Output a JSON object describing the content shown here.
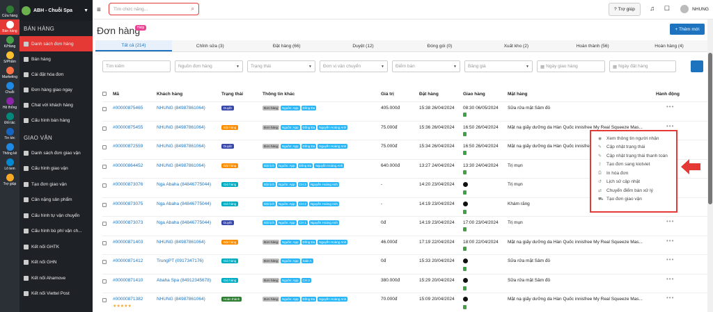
{
  "rail": [
    {
      "label": "Cửa hàng",
      "color": "#2e7d32"
    },
    {
      "label": "Bán hàng",
      "color": "#e53935",
      "active": true
    },
    {
      "label": "K/Hàng",
      "color": "#43a047"
    },
    {
      "label": "S/Phẩm",
      "color": "#fbc02d"
    },
    {
      "label": "Marketing",
      "color": "#ff7043"
    },
    {
      "label": "Chuỗi",
      "color": "#1e88e5"
    },
    {
      "label": "Hệ thống",
      "color": "#8e24aa"
    },
    {
      "label": "Đối tác",
      "color": "#00897b"
    },
    {
      "label": "Tin tức",
      "color": "#1565c0"
    },
    {
      "label": "Thống kê",
      "color": "#1e88e5"
    },
    {
      "label": "Lô tem",
      "color": "#0288d1"
    },
    {
      "label": "Trợ giúp",
      "color": "#f9a825"
    }
  ],
  "brand": {
    "name": "ABH - Chuỗi Spa"
  },
  "sidebar": {
    "sales_title": "BÁN HÀNG",
    "sales": [
      {
        "label": "Danh sách đơn hàng",
        "active": true
      },
      {
        "label": "Bán hàng"
      },
      {
        "label": "Cài đặt hóa đơn"
      },
      {
        "label": "Đơn hàng giao ngay"
      },
      {
        "label": "Chat với khách hàng"
      },
      {
        "label": "Cấu hình bán hàng"
      }
    ],
    "ship_title": "GIAO VẬN",
    "ship": [
      {
        "label": "Danh sách đơn giao vận"
      },
      {
        "label": "Cấu hình giao vận"
      },
      {
        "label": "Tạo đơn giao vận"
      },
      {
        "label": "Cân nặng sản phẩm"
      },
      {
        "label": "Cấu hình tự vận chuyển"
      },
      {
        "label": "Cấu hình bù phí vận ch..."
      },
      {
        "label": "Kết nối GHTK"
      },
      {
        "label": "Kết nối GHN"
      },
      {
        "label": "Kết nối Ahamove"
      },
      {
        "label": "Kết nối Viettel Post"
      }
    ]
  },
  "topbar": {
    "search_placeholder": "Tìm chức năng...",
    "help": "Trợ giúp",
    "user": "NHUNG"
  },
  "page": {
    "title": "Đơn hàng",
    "help_badge": "Help",
    "add_button": "+ Thêm mới"
  },
  "tabs": [
    "Tất cả (214)",
    "Chỉnh sửa (3)",
    "Đặt hàng (66)",
    "Duyệt (12)",
    "Đóng gói (0)",
    "Xuất kho (2)",
    "Hoàn thành (56)",
    "Hoàn hàng (4)"
  ],
  "filters": {
    "search": "Tìm kiếm",
    "source": "Nguồn đơn hàng",
    "status": "Trạng thái",
    "carrier": "Đơn vị vận chuyển",
    "point": "Điểm bán",
    "price": "Bảng giá",
    "ship_date": "Ngày giao hàng",
    "order_date": "Ngày đặt hàng"
  },
  "columns": [
    "Mã",
    "Khách hàng",
    "Trạng thái",
    "Thông tin khác",
    "Giá trị",
    "Đặt hàng",
    "Giao hàng",
    "Mặt hàng",
    "Hành động"
  ],
  "rows": [
    {
      "code": "#00000875465",
      "customer": "NHUNG (84987861064)",
      "status": "Duyệt",
      "status_color": "#3949ab",
      "tags": [
        [
          "Đơn hàng",
          "g"
        ],
        [
          "Nguồn: App",
          "c"
        ],
        [
          "Đống Đa",
          "c"
        ]
      ],
      "value": "405.000đ",
      "ordered": "15:38 26/04/2024",
      "delivery": "08:30 06/05/2024",
      "dtype": "green",
      "item": "Sữa rửa mặt Sâm đỏ"
    },
    {
      "code": "#00000875455",
      "customer": "NHUNG (84987861064)",
      "status": "Đặt hàng",
      "status_color": "#fb8c00",
      "tags": [
        [
          "Đơn hàng",
          "g"
        ],
        [
          "Nguồn: App",
          "c"
        ],
        [
          "Đống Đa",
          "c"
        ],
        [
          "Nguyễn Hoàng Anh",
          "c"
        ]
      ],
      "value": "75.000đ",
      "ordered": "15:36 26/04/2024",
      "delivery": "16:50 26/04/2024",
      "dtype": "green",
      "item": "Mặt nạ giấy dưỡng da Hàn Quốc innisfree My Real Squeeze Mas..."
    },
    {
      "code": "#00000872559",
      "customer": "NHUNG (84987861064)",
      "status": "Duyệt",
      "status_color": "#3949ab",
      "tags": [
        [
          "Đơn hàng",
          "g"
        ],
        [
          "Nguồn: App",
          "c"
        ],
        [
          "Đống Đa",
          "c"
        ],
        [
          "Nguyễn Hoàng Anh",
          "c"
        ]
      ],
      "value": "75.000đ",
      "ordered": "15:34 26/04/2024",
      "delivery": "16:50 26/04/2024",
      "dtype": "green",
      "item": "Mặt nạ giấy dưỡng da Hàn Quốc innisfree My Real Squeeze Mas..."
    },
    {
      "code": "#00000864452",
      "customer": "NHUNG (84987861064)",
      "status": "Đặt hàng",
      "status_color": "#fb8c00",
      "tags": [
        [
          "Đặt lịch",
          "c"
        ],
        [
          "Nguồn: App",
          "c"
        ],
        [
          "Đống Đa",
          "c"
        ],
        [
          "Nguyễn Hoàng Anh",
          "c"
        ]
      ],
      "value": "640.000đ",
      "ordered": "13:27 24/04/2024",
      "delivery": "13:30 24/04/2024",
      "dtype": "green",
      "item": "Trị mụn"
    },
    {
      "code": "#00000873076",
      "customer": "Nga Abaha (84846775044)",
      "status": "Giỏ hàng",
      "status_color": "#00acc1",
      "tags": [
        [
          "Đặt lịch",
          "c"
        ],
        [
          "Nguồn: App",
          "c"
        ],
        [
          "CH 2",
          "c"
        ],
        [
          "Nguyễn Hoàng Anh",
          "c"
        ]
      ],
      "value": "-",
      "ordered": "14:20 23/04/2024",
      "delivery": "",
      "dtype": "black",
      "item": "Trị mụn"
    },
    {
      "code": "#00000873075",
      "customer": "Nga Abaha (84846775044)",
      "status": "Giỏ hàng",
      "status_color": "#00acc1",
      "tags": [
        [
          "Đặt lịch",
          "c"
        ],
        [
          "Nguồn: App",
          "c"
        ],
        [
          "CH 2",
          "c"
        ],
        [
          "Nguyễn Hoàng Anh",
          "c"
        ]
      ],
      "value": "-",
      "ordered": "14:19 23/04/2024",
      "delivery": "",
      "dtype": "black",
      "item": "Khám răng"
    },
    {
      "code": "#00000873073",
      "customer": "Nga Abaha (84846775044)",
      "status": "Duyệt",
      "status_color": "#3949ab",
      "tags": [
        [
          "Đặt lịch",
          "c"
        ],
        [
          "Nguồn: App",
          "c"
        ],
        [
          "CH 1",
          "c"
        ],
        [
          "Nguyễn Hoàng Anh",
          "c"
        ]
      ],
      "value": "0đ",
      "ordered": "14:19 23/04/2024",
      "delivery": "17:00 23/04/2024",
      "dtype": "green",
      "item": "Trị mụn"
    },
    {
      "code": "#00000871403",
      "customer": "NHUNG (84987861064)",
      "status": "Đặt hàng",
      "status_color": "#fb8c00",
      "tags": [
        [
          "Đơn hàng",
          "g"
        ],
        [
          "Nguồn: App",
          "c"
        ],
        [
          "Đống Đa",
          "c"
        ],
        [
          "Nguyễn Hoàng Anh",
          "c"
        ]
      ],
      "value": "46.000đ",
      "ordered": "17:19 22/04/2024",
      "delivery": "18:00 22/04/2024",
      "dtype": "green",
      "item": "Mặt nạ giấy dưỡng da Hàn Quốc innisfree My Real Squeeze Mas..."
    },
    {
      "code": "#00000871412",
      "customer": "TrungPT (0917347176)",
      "status": "Giỏ hàng",
      "status_color": "#00acc1",
      "tags": [
        [
          "Đơn hàng",
          "g"
        ],
        [
          "Nguồn: App",
          "c"
        ],
        [
          "Sale A",
          "c"
        ]
      ],
      "value": "0đ",
      "ordered": "15:33 20/04/2024",
      "delivery": "",
      "dtype": "black",
      "item": "Sữa rửa mặt Sâm đỏ"
    },
    {
      "code": "#00000871410",
      "customer": "Abaha Spa (84912345678)",
      "status": "Giỏ hàng",
      "status_color": "#00acc1",
      "tags": [
        [
          "Đơn hàng",
          "g"
        ],
        [
          "Nguồn: App",
          "c"
        ],
        [
          "CH 3",
          "c"
        ]
      ],
      "value": "380.000đ",
      "ordered": "15:29 20/04/2024",
      "delivery": "",
      "dtype": "black",
      "item": "Sữa rửa mặt Sâm đỏ"
    },
    {
      "code": "#00000871382",
      "customer": "NHUNG (84987861064)",
      "status": "Hoàn thành",
      "status_color": "#2e7d32",
      "tags": [
        [
          "Đơn hàng",
          "g"
        ],
        [
          "Nguồn: App",
          "c"
        ],
        [
          "Đống Đa",
          "c"
        ],
        [
          "Nguyễn Hoàng Anh",
          "c"
        ]
      ],
      "value": "70.000đ",
      "ordered": "15:09 20/04/2024",
      "delivery": "",
      "dtype": "black",
      "item": "Mặt nạ giấy dưỡng da Hàn Quốc innisfree My Real Squeeze Mas...",
      "stars": "★★★★★"
    }
  ],
  "action_menu": [
    "Xem thông tin người nhận",
    "Cập nhật trạng thái",
    "Cập nhật trạng thái thanh toán",
    "Tạo đơn sang kiotviet",
    "In hóa đơn",
    "Lịch sử cập nhật",
    "Chuyển điểm bán xử lý",
    "Tạo đơn giao vận"
  ],
  "action_dots": "•••",
  "colors": {
    "accent": "#e53935",
    "primary": "#1e73be",
    "sidebar": "#1e2126"
  }
}
